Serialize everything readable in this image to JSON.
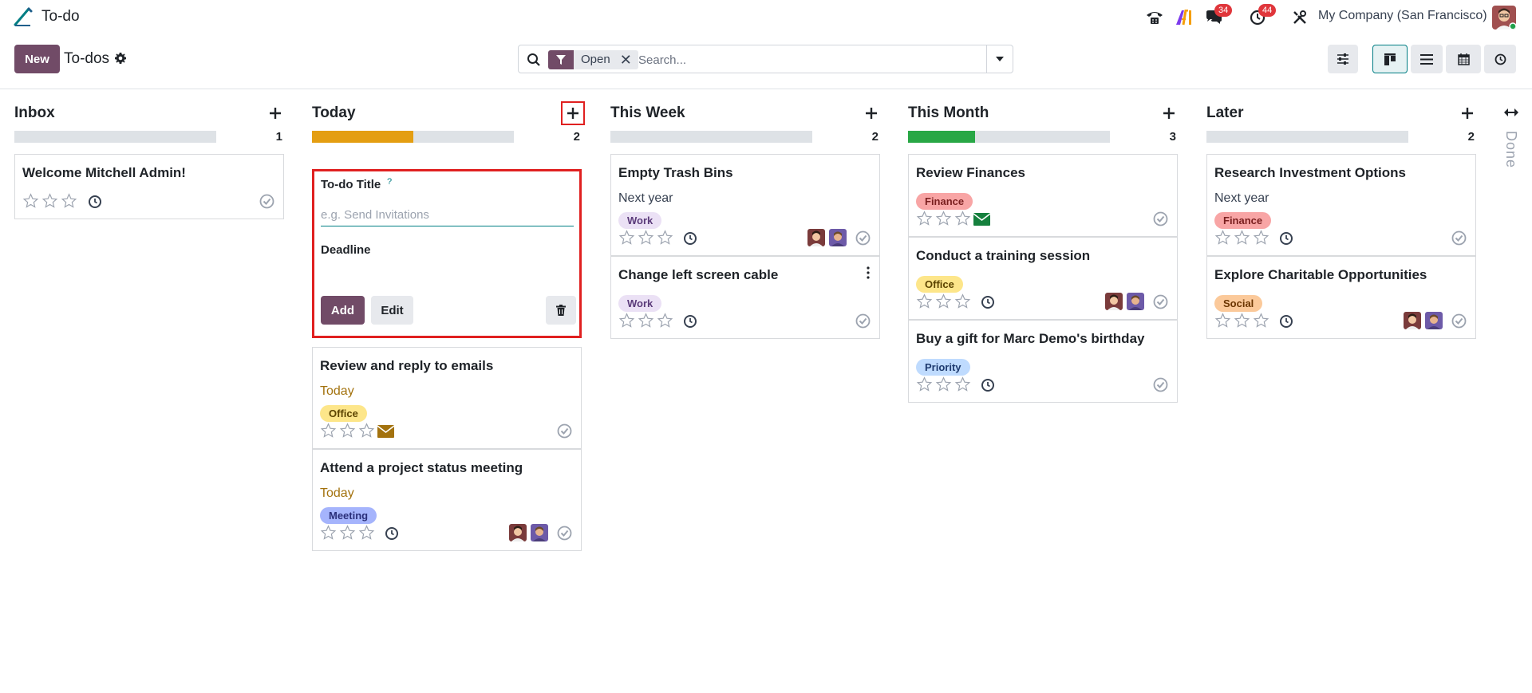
{
  "navbar": {
    "app_name": "To-do",
    "chat_badge": "34",
    "activity_badge": "44",
    "company": "My Company (San Francisco)"
  },
  "control": {
    "new_label": "New",
    "breadcrumb": "To-dos",
    "facet": "Open",
    "search_placeholder": "Search...",
    "views": [
      "kanban",
      "list",
      "calendar",
      "activity"
    ],
    "active_view": "kanban"
  },
  "colors": {
    "brand": "#714b67",
    "teal": "#017e84",
    "progress_orange": "#e49e12",
    "progress_green": "#28a745",
    "highlight": "#e02020"
  },
  "columns": [
    {
      "title": "Inbox",
      "count": "1",
      "progress": [],
      "cards": [
        {
          "title": "Welcome Mitchell Admin!",
          "sub": "",
          "tag": null,
          "mail": false,
          "avatars": 0
        }
      ]
    },
    {
      "title": "Today",
      "count": "2",
      "progress": [
        {
          "color": "#e49e12",
          "fraction": 0.5
        }
      ],
      "quick_create": {
        "title_label": "To-do Title",
        "help": "?",
        "title_placeholder": "e.g. Send Invitations",
        "deadline_label": "Deadline",
        "add_label": "Add",
        "edit_label": "Edit"
      },
      "cards": [
        {
          "title": "Review and reply to emails",
          "sub": "Today",
          "tag": "Office",
          "mail": true,
          "avatars": 0
        },
        {
          "title": "Attend a project status meeting",
          "sub": "Today",
          "tag": "Meeting",
          "mail": false,
          "avatars": 2
        }
      ]
    },
    {
      "title": "This Week",
      "count": "2",
      "progress": [],
      "cards": [
        {
          "title": "Empty Trash Bins",
          "sub": "Next year",
          "tag": "Work",
          "mail": false,
          "avatars": 2
        },
        {
          "title": "Change left screen cable",
          "sub": "",
          "tag": "Work",
          "mail": false,
          "avatars": 0,
          "menu": true
        }
      ]
    },
    {
      "title": "This Month",
      "count": "3",
      "progress": [
        {
          "color": "#28a745",
          "fraction": 0.333
        }
      ],
      "cards": [
        {
          "title": "Review Finances",
          "sub": "",
          "tag": "Finance",
          "mail": true,
          "avatars": 0
        },
        {
          "title": "Conduct a training session",
          "sub": "",
          "tag": "Office",
          "mail": false,
          "avatars": 2
        },
        {
          "title": "Buy a gift for Marc Demo's birthday",
          "sub": "",
          "tag": "Priority",
          "mail": false,
          "avatars": 0
        }
      ]
    },
    {
      "title": "Later",
      "count": "2",
      "progress": [],
      "cards": [
        {
          "title": "Research Investment Options",
          "sub": "Next year",
          "tag": "Finance",
          "mail": false,
          "avatars": 0
        },
        {
          "title": "Explore Charitable Opportunities",
          "sub": "",
          "tag": "Social",
          "mail": false,
          "avatars": 2
        }
      ]
    }
  ],
  "tag_colors": {
    "Work": {
      "bg": "#ebe1f5",
      "fg": "#5b3b7a"
    },
    "Office": {
      "bg": "#fde68a",
      "fg": "#5c4400"
    },
    "Meeting": {
      "bg": "#a5b4fc",
      "fg": "#2b2f7a"
    },
    "Finance": {
      "bg": "#f8a5a5",
      "fg": "#7a1f1f"
    },
    "Priority": {
      "bg": "#bfdbfe",
      "fg": "#1e3a6e"
    },
    "Social": {
      "bg": "#fbc99a",
      "fg": "#6b3500"
    }
  },
  "folded_column": "Done"
}
